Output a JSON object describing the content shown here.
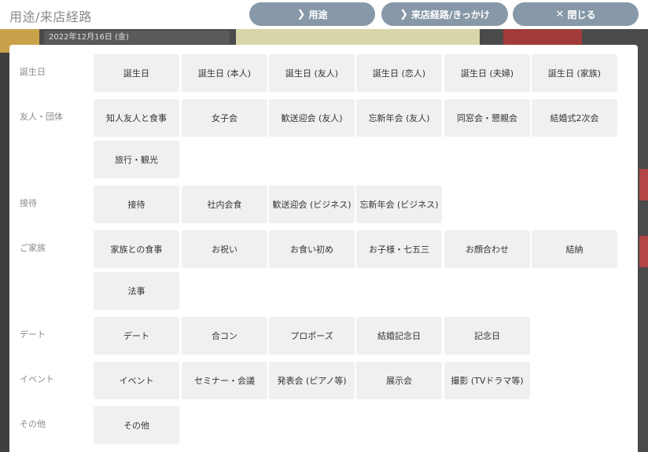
{
  "header": {
    "title": "用途/来店経路",
    "buttons": {
      "usage": {
        "icon": "chevron-right-icon",
        "glyph": "❯",
        "label": "用途"
      },
      "route": {
        "icon": "chevron-right-icon",
        "glyph": "❯",
        "label": "来店経路/きっかけ"
      },
      "close": {
        "icon": "close-icon",
        "glyph": "✕",
        "label": "閉じる"
      }
    }
  },
  "background": {
    "date_text": "2022年12月16日 (金)"
  },
  "categories": [
    {
      "label": "誕生日",
      "options": [
        "誕生日",
        "誕生日 (本人)",
        "誕生日 (友人)",
        "誕生日 (恋人)",
        "誕生日 (夫婦)",
        "誕生日 (家族)"
      ]
    },
    {
      "label": "友人・団体",
      "options": [
        "知人友人と食事",
        "女子会",
        "歓送迎会 (友人)",
        "忘新年会 (友人)",
        "同窓会・懇親会",
        "結婚式2次会",
        "旅行・観光"
      ]
    },
    {
      "label": "接待",
      "options": [
        "接待",
        "社内会食",
        "歓送迎会 (ビジネス)",
        "忘新年会 (ビジネス)"
      ]
    },
    {
      "label": "ご家族",
      "options": [
        "家族との食事",
        "お祝い",
        "お食い初め",
        "お子様・七五三",
        "お顔合わせ",
        "結納",
        "法事"
      ]
    },
    {
      "label": "デート",
      "options": [
        "デート",
        "合コン",
        "プロポーズ",
        "結婚記念日",
        "記念日"
      ]
    },
    {
      "label": "イベント",
      "options": [
        "イベント",
        "セミナー・会議",
        "発表会 (ピアノ等)",
        "展示会",
        "撮影 (TVドラマ等)"
      ]
    },
    {
      "label": "その他",
      "options": [
        "その他"
      ]
    }
  ],
  "colors": {
    "header_button": "#8798a8",
    "option_bg": "#f0f0f1",
    "label_text": "#8a8a8a"
  }
}
